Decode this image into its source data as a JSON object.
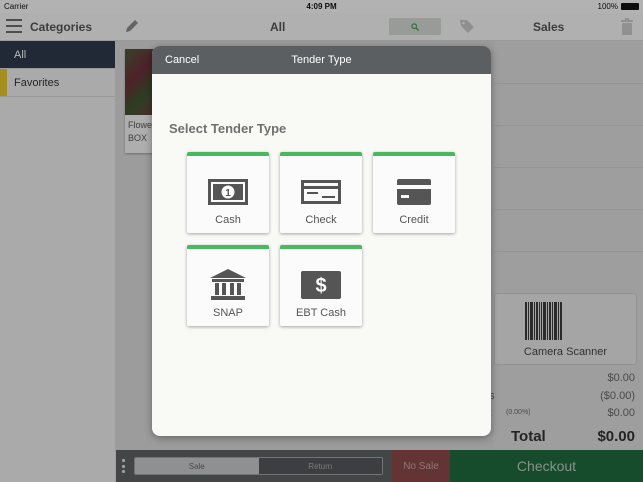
{
  "status_bar": {
    "carrier": "Carrier",
    "time": "4:09 PM",
    "battery": "100%"
  },
  "top_nav": {
    "categories_label": "Categories",
    "all_label": "All",
    "sales_label": "Sales"
  },
  "sidebar": {
    "items": [
      {
        "label": "All",
        "active": true
      },
      {
        "label": "Favorites",
        "active": false
      }
    ]
  },
  "product": {
    "line1": "Flowe",
    "line2": "BOX"
  },
  "sale_panel": {
    "scanner_label": "Camera Scanner",
    "rows": [
      {
        "label": "al",
        "value": "$0.00"
      },
      {
        "label": "nts",
        "value": "($0.00)"
      },
      {
        "label": "ax",
        "pct": "(0.00%)",
        "value": "$0.00"
      }
    ],
    "total_label": "Total",
    "total_value": "$0.00"
  },
  "bottom_bar": {
    "sale_label": "Sale",
    "return_label": "Return",
    "no_sale_label": "No Sale",
    "checkout_label": "Checkout"
  },
  "modal": {
    "cancel_label": "Cancel",
    "title": "Tender Type",
    "subtitle": "Select Tender Type",
    "tenders": [
      {
        "label": "Cash",
        "icon": "cash-icon"
      },
      {
        "label": "Check",
        "icon": "check-icon"
      },
      {
        "label": "Credit",
        "icon": "credit-card-icon"
      },
      {
        "label": "SNAP",
        "icon": "bank-icon"
      },
      {
        "label": "EBT Cash",
        "icon": "dollar-card-icon"
      }
    ]
  },
  "colors": {
    "accent_green": "#4ab860",
    "nav_dark": "#2d3a4a",
    "checkout_green": "#1f6a3c",
    "no_sale_red": "#8b4748",
    "favorites_marker": "#e3c52c"
  }
}
